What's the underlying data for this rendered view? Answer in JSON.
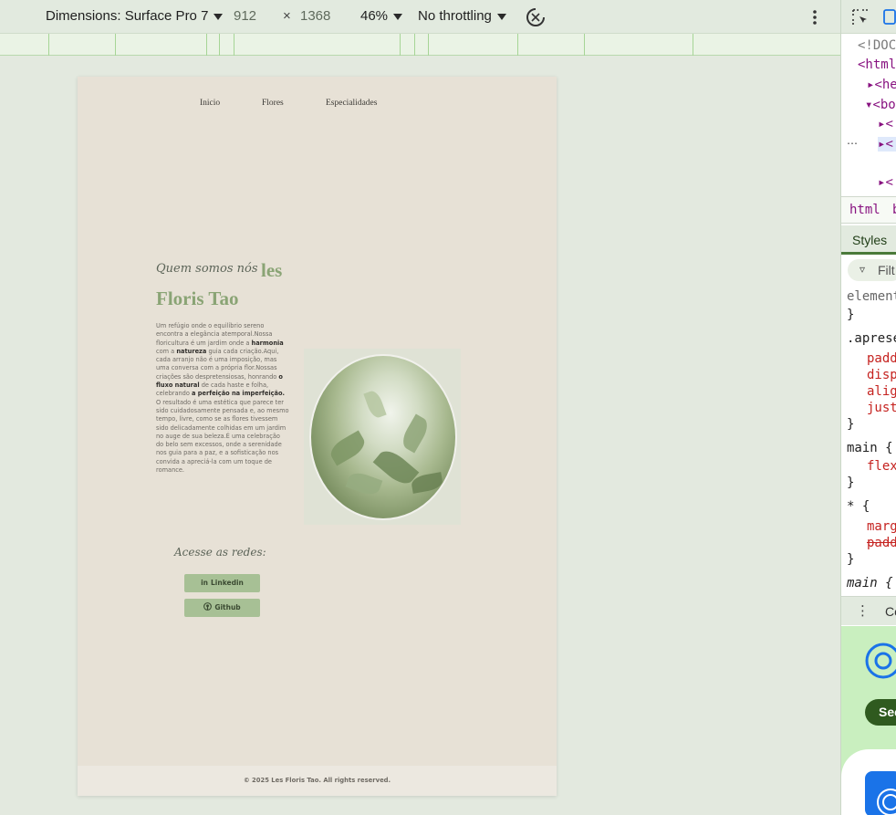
{
  "toolbar": {
    "dimensions_label": "Dimensions: Surface Pro 7",
    "width": "912",
    "height": "1368",
    "times": "×",
    "zoom": "46%",
    "throttling": "No throttling"
  },
  "site": {
    "nav": [
      "Inicio",
      "Flores",
      "Especialidades"
    ],
    "title_script": "Quem somos nós",
    "title_les": "les",
    "title_floris": "Floris Tao",
    "about": [
      {
        "t": "Um refúgio onde o equilíbrio sereno encontra a elegância atemporal."
      },
      {
        "t": "Nossa floricultura é um jardim onde a "
      },
      {
        "b": "harmonia"
      },
      {
        "t": " com a "
      },
      {
        "b": "natureza"
      },
      {
        "t": " guia cada criação."
      },
      {
        "t": "Aqui, cada arranjo não é uma imposição, mas uma conversa com a própria flor."
      },
      {
        "t": "Nossas criações são despretensiosas, honrando "
      },
      {
        "b": "o fluxo natural"
      },
      {
        "t": " de cada haste e folha, celebrando "
      },
      {
        "b": "a perfeição na imperfeição."
      },
      {
        "t": " O resultado é uma estética que parece ter sido cuidadosamente pensada e, ao mesmo tempo, livre, como se as flores tivessem sido delicadamente colhidas em um jardim no auge de sua beleza.É uma celebração do belo sem excessos, onde a serenidade nos guia para a paz, e a sofisticação nos convida a apreciá-la com um toque de romance."
      }
    ],
    "networks_title": "Acesse as redes:",
    "linkedin": "Linkedin",
    "github": "Github",
    "linkedin_icon": "in",
    "github_icon": "github-icon",
    "footer": "© 2025 Les Floris Tao. All rights reserved."
  },
  "devtools": {
    "elements": [
      "<!DOCT",
      "<html",
      "<he",
      "<bo",
      "<",
      "<",
      "<"
    ],
    "crumbs": [
      "html",
      "b"
    ],
    "tab": "Styles",
    "filter": "Filt",
    "rules": [
      "element",
      "}",
      ".aprese",
      "padd",
      "disp",
      "alig",
      "just",
      "}",
      "main {",
      "flex",
      "}",
      "* {",
      "marg",
      "padd",
      "}",
      "main {"
    ],
    "console_label": "Co",
    "button": "See"
  }
}
